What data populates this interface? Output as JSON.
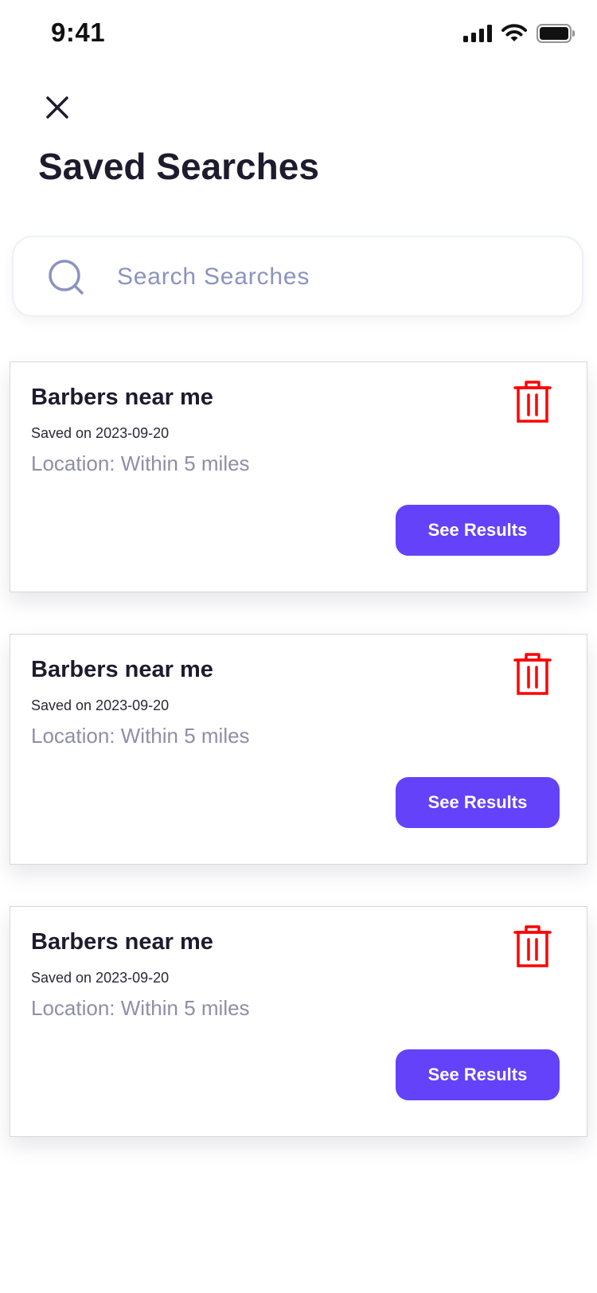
{
  "status_bar": {
    "time": "9:41"
  },
  "header": {
    "title": "Saved Searches"
  },
  "search": {
    "placeholder": "Search Searches",
    "value": ""
  },
  "colors": {
    "accent": "#6342f9",
    "delete": "#ff0000",
    "title": "#1e1b2e",
    "muted": "#8f8ea6"
  },
  "icons": {
    "close": "close-icon",
    "search": "search-icon",
    "delete": "trash-icon"
  },
  "saved_searches": [
    {
      "title": "Barbers near me",
      "saved": "Saved on 2023-09-20",
      "location": "Location: Within 5 miles",
      "button": "See Results"
    },
    {
      "title": "Barbers near me",
      "saved": "Saved on 2023-09-20",
      "location": "Location: Within 5 miles",
      "button": "See Results"
    },
    {
      "title": "Barbers near me",
      "saved": "Saved on 2023-09-20",
      "location": "Location: Within 5 miles",
      "button": "See Results"
    }
  ]
}
